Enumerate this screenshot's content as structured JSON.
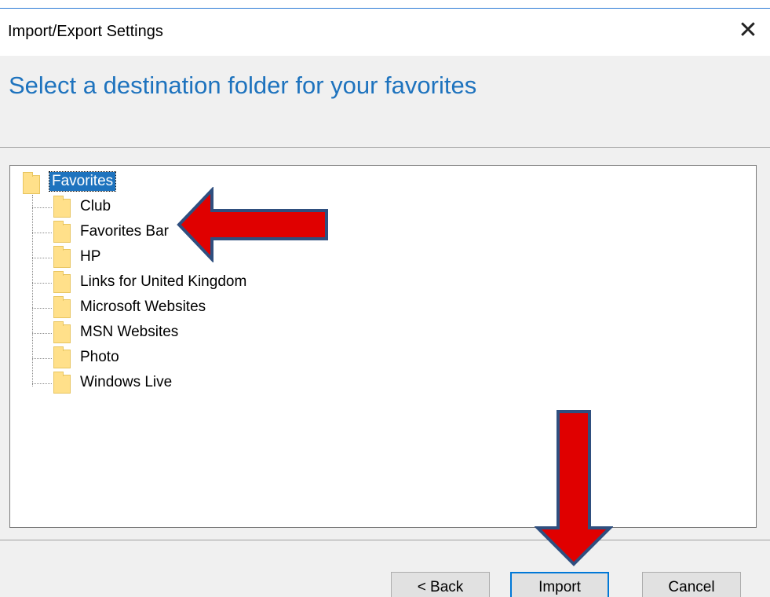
{
  "window": {
    "title": "Import/Export Settings",
    "close_glyph": "✕"
  },
  "header": {
    "heading": "Select a destination folder for your favorites"
  },
  "tree": {
    "root": {
      "label": "Favorites",
      "icon": "folder-icon",
      "selected": true
    },
    "items": [
      {
        "label": "Club",
        "icon": "folder-icon"
      },
      {
        "label": "Favorites Bar",
        "icon": "folder-icon"
      },
      {
        "label": "HP",
        "icon": "folder-icon"
      },
      {
        "label": "Links for United Kingdom",
        "icon": "folder-icon"
      },
      {
        "label": "Microsoft Websites",
        "icon": "folder-icon"
      },
      {
        "label": "MSN Websites",
        "icon": "folder-icon"
      },
      {
        "label": "Photo",
        "icon": "folder-icon"
      },
      {
        "label": "Windows Live",
        "icon": "folder-icon"
      }
    ]
  },
  "buttons": {
    "back": "< Back",
    "import": "Import",
    "cancel": "Cancel"
  },
  "annotations": {
    "arrow_color": "#e00000",
    "arrow_outline": "#2f4f7f",
    "arrow_1_target": "Favorites Bar",
    "arrow_2_target": "Import"
  },
  "colors": {
    "accent": "#1e73be",
    "selection": "#1e73be",
    "folder": "#ffe08a"
  }
}
